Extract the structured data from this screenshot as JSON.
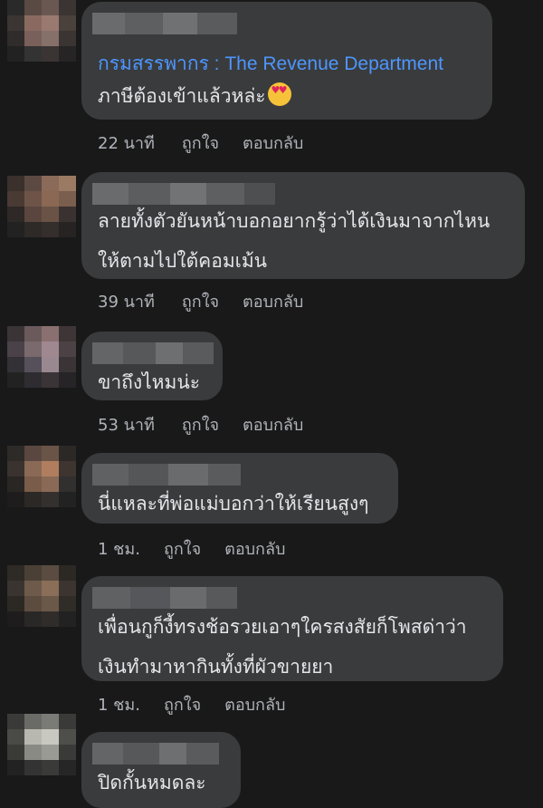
{
  "comments": [
    {
      "page_name": "กรมสรรพากร : The Revenue Department",
      "lines": [
        "ภาษีต้องเข้าแล้วหล่ะ"
      ],
      "emoji": "smiling-face-with-heart-eyes-icon",
      "time": "22 นาที",
      "like": "ถูกใจ",
      "reply": "ตอบกลับ"
    },
    {
      "lines": [
        "ลายทั้งตัวยันหน้าบอกอยากรู้ว่าได้เงินมาจากไหน",
        "ให้ตามไปใต้คอมเม้น"
      ],
      "time": "39 นาที",
      "like": "ถูกใจ",
      "reply": "ตอบกลับ"
    },
    {
      "lines": [
        "ขาถึงไหมน่ะ"
      ],
      "time": "53 นาที",
      "like": "ถูกใจ",
      "reply": "ตอบกลับ"
    },
    {
      "lines": [
        "นี่แหละที่พ่อแม่บอกว่าให้เรียนสูงๆ"
      ],
      "time": "1 ชม.",
      "like": "ถูกใจ",
      "reply": "ตอบกลับ"
    },
    {
      "lines": [
        "เพื่อนกูก็งี้ทรงช้อรวยเอาๆใครสงสัยก็โพสด่าว่า",
        "เงินทำมาหากินทั้งที่ผัวขายยา"
      ],
      "time": "1 ชม.",
      "like": "ถูกใจ",
      "reply": "ตอบกลับ"
    },
    {
      "lines": [
        "ปิดกั้นหมดละ"
      ]
    }
  ],
  "colors": {
    "background": "#19191a",
    "bubble": "#3a3b3c",
    "text": "#e4e6eb",
    "meta": "#b0b3b8",
    "link": "#4d96ff"
  }
}
